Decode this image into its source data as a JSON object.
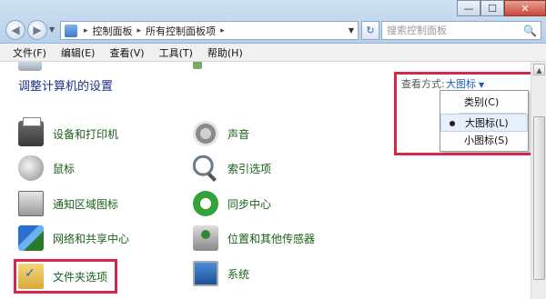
{
  "window": {
    "minimize_label": "—",
    "maximize_label": "☐",
    "close_label": "✕"
  },
  "nav": {
    "back_glyph": "◀",
    "forward_glyph": "▶",
    "dropdown_glyph": "▼",
    "refresh_glyph": "↻"
  },
  "address": {
    "crumbs": [
      "控制面板",
      "所有控制面板项"
    ],
    "separator": "▸",
    "dropdown_glyph": "▼"
  },
  "search": {
    "placeholder": "搜索控制面板",
    "icon_glyph": "🔍"
  },
  "menu": [
    "文件(F)",
    "编辑(E)",
    "查看(V)",
    "工具(T)",
    "帮助(H)"
  ],
  "content": {
    "header": "调整计算机的设置",
    "view_by_label": "查看方式:",
    "view_by_value": "大图标",
    "view_by_caret": "▼"
  },
  "dropdown": {
    "items": [
      "类别(C)",
      "大图标(L)",
      "小图标(S)"
    ],
    "selected_index": 1
  },
  "items": [
    {
      "label": "设备和打印机",
      "icon": "printer-icon"
    },
    {
      "label": "声音",
      "icon": "speaker-icon"
    },
    {
      "label": "鼠标",
      "icon": "mouse-icon"
    },
    {
      "label": "索引选项",
      "icon": "indexing-icon"
    },
    {
      "label": "通知区域图标",
      "icon": "notification-tray-icon"
    },
    {
      "label": "同步中心",
      "icon": "sync-icon"
    },
    {
      "label": "网络和共享中心",
      "icon": "network-icon"
    },
    {
      "label": "位置和其他传感器",
      "icon": "location-sensor-icon"
    },
    {
      "label": "文件夹选项",
      "icon": "folder-options-icon"
    },
    {
      "label": "系统",
      "icon": "system-icon"
    }
  ],
  "colors": {
    "highlight": "#d6274a",
    "link_green": "#1a5f1a",
    "header_blue": "#1e3287"
  },
  "scrollbar": {
    "up_glyph": "▲"
  }
}
